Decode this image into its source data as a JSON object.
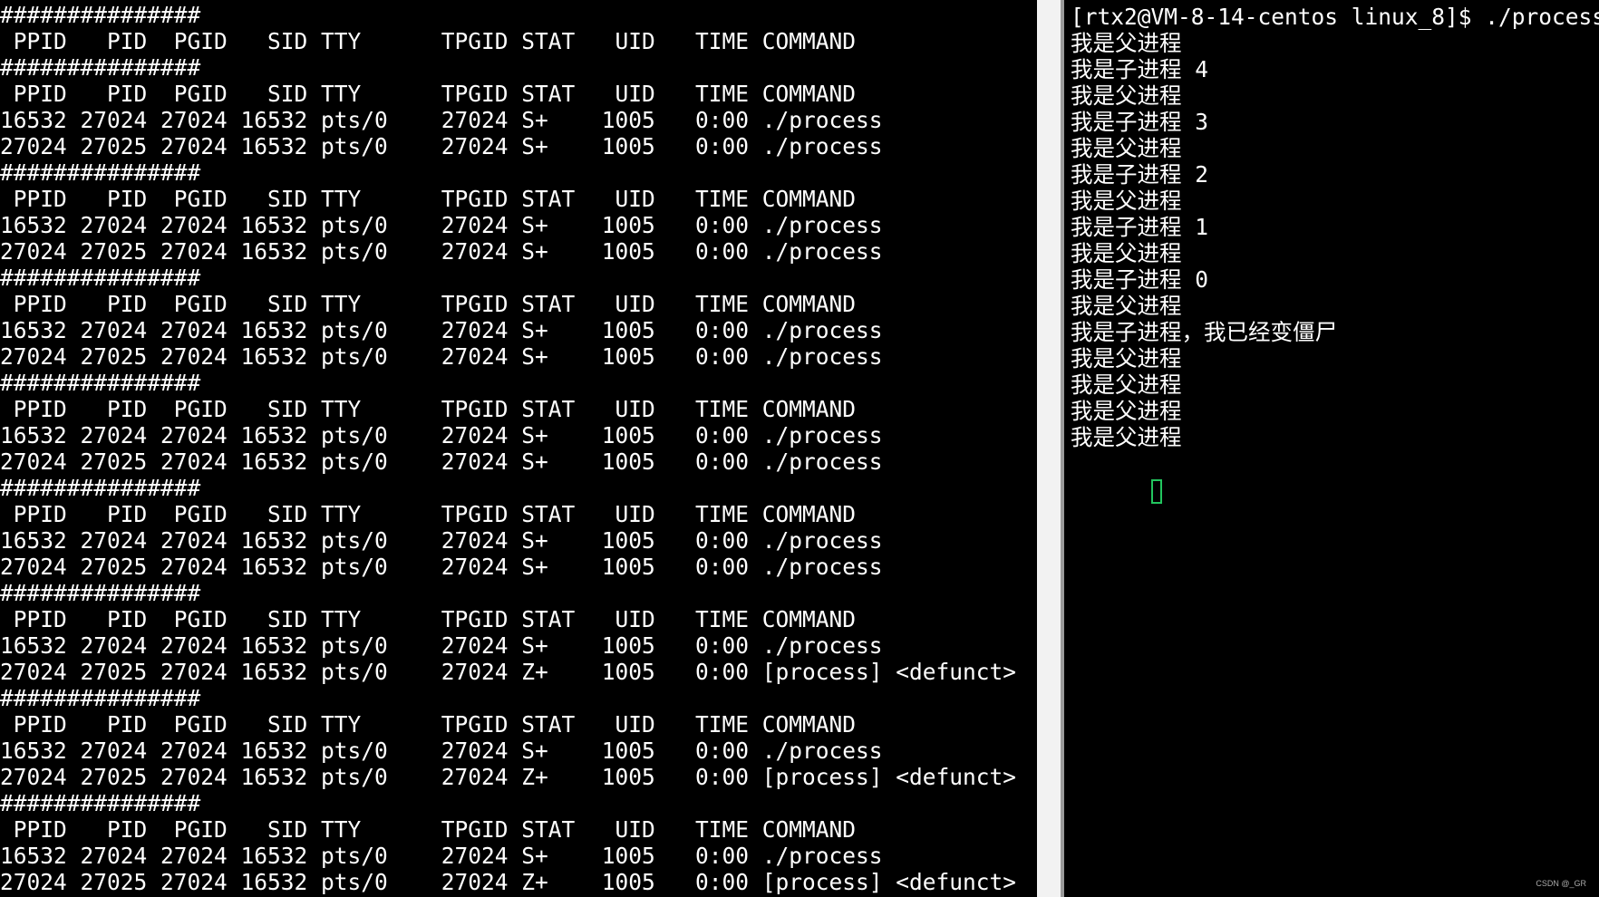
{
  "left_terminal": {
    "lines": [
      "###############",
      " PPID   PID  PGID   SID TTY      TPGID STAT   UID   TIME COMMAND",
      "###############",
      " PPID   PID  PGID   SID TTY      TPGID STAT   UID   TIME COMMAND",
      "16532 27024 27024 16532 pts/0    27024 S+    1005   0:00 ./process",
      "27024 27025 27024 16532 pts/0    27024 S+    1005   0:00 ./process",
      "###############",
      " PPID   PID  PGID   SID TTY      TPGID STAT   UID   TIME COMMAND",
      "16532 27024 27024 16532 pts/0    27024 S+    1005   0:00 ./process",
      "27024 27025 27024 16532 pts/0    27024 S+    1005   0:00 ./process",
      "###############",
      " PPID   PID  PGID   SID TTY      TPGID STAT   UID   TIME COMMAND",
      "16532 27024 27024 16532 pts/0    27024 S+    1005   0:00 ./process",
      "27024 27025 27024 16532 pts/0    27024 S+    1005   0:00 ./process",
      "###############",
      " PPID   PID  PGID   SID TTY      TPGID STAT   UID   TIME COMMAND",
      "16532 27024 27024 16532 pts/0    27024 S+    1005   0:00 ./process",
      "27024 27025 27024 16532 pts/0    27024 S+    1005   0:00 ./process",
      "###############",
      " PPID   PID  PGID   SID TTY      TPGID STAT   UID   TIME COMMAND",
      "16532 27024 27024 16532 pts/0    27024 S+    1005   0:00 ./process",
      "27024 27025 27024 16532 pts/0    27024 S+    1005   0:00 ./process",
      "###############",
      " PPID   PID  PGID   SID TTY      TPGID STAT   UID   TIME COMMAND",
      "16532 27024 27024 16532 pts/0    27024 S+    1005   0:00 ./process",
      "27024 27025 27024 16532 pts/0    27024 Z+    1005   0:00 [process] <defunct>",
      "###############",
      " PPID   PID  PGID   SID TTY      TPGID STAT   UID   TIME COMMAND",
      "16532 27024 27024 16532 pts/0    27024 S+    1005   0:00 ./process",
      "27024 27025 27024 16532 pts/0    27024 Z+    1005   0:00 [process] <defunct>",
      "###############",
      " PPID   PID  PGID   SID TTY      TPGID STAT   UID   TIME COMMAND",
      "16532 27024 27024 16532 pts/0    27024 S+    1005   0:00 ./process",
      "27024 27025 27024 16532 pts/0    27024 Z+    1005   0:00 [process] <defunct>"
    ]
  },
  "right_terminal": {
    "lines": [
      "[rtx2@VM-8-14-centos linux_8]$ ./process",
      "我是父进程",
      "我是子进程 4",
      "我是父进程",
      "我是子进程 3",
      "我是父进程",
      "我是子进程 2",
      "我是父进程",
      "我是子进程 1",
      "我是父进程",
      "我是子进程 0",
      "我是父进程",
      "我是子进程，我已经变僵尸",
      "我是父进程",
      "我是父进程",
      "我是父进程",
      "我是父进程"
    ],
    "cursor_color": "#22c55e"
  },
  "watermark": "CSDN @_GR"
}
